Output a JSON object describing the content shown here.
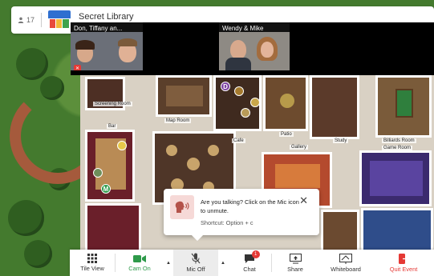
{
  "topbar": {
    "participant_count": "17",
    "event_title": "Secret Library"
  },
  "videos": [
    {
      "name": "Don, Tiffany an..."
    },
    {
      "name": "Wendy & Mike"
    }
  ],
  "map": {
    "rooms": [
      "Screening Room",
      "Bar",
      "Map Room",
      "Cafe",
      "Patio",
      "Gallery",
      "Study",
      "Billiards Room",
      "Game Room"
    ],
    "avatars": [
      {
        "initial": "D",
        "color": "#7b3fa0"
      },
      {
        "initial": "M",
        "color": "#2e9a4a"
      }
    ]
  },
  "toast": {
    "message": "Are you talking? Click on the Mic icon to unmute.",
    "shortcut": "Shortcut: Option + c"
  },
  "toolbar": {
    "tile_view": "Tile View",
    "cam_on": "Cam On",
    "mic_off": "Mic Off",
    "chat": "Chat",
    "chat_badge": "1",
    "share": "Share",
    "whiteboard": "Whiteboard",
    "quit": "Quit Event"
  },
  "colors": {
    "accent_green": "#2e9a4a",
    "quit_red": "#e53935"
  }
}
